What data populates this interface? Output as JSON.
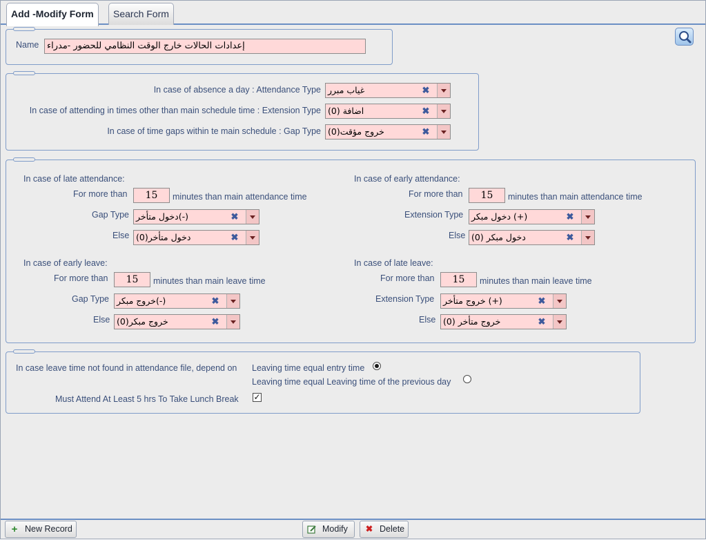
{
  "tabs": [
    {
      "label": "Add -Modify Form",
      "active": true
    },
    {
      "label": "Search Form",
      "active": false
    }
  ],
  "name_section": {
    "label": "Name",
    "value": "إعدادات الحالات  خارج الوقت النظامي للحضور -مدراء"
  },
  "types_section": {
    "absence_label": "In case of absence a day : Attendance Type",
    "absence_value": "غياب مبرر",
    "extension_label": "In case of attending in times other than main schedule time : Extension Type",
    "extension_value": "اضافة (0)",
    "gap_label": "In case of time gaps within te main schedule : Gap Type",
    "gap_value": "خروج مؤقت(0)"
  },
  "rules_section": {
    "late_attendance": {
      "header": "In case of late attendance:",
      "for_more_than": "For more than",
      "minutes": "15",
      "suffix": "minutes than main attendance time",
      "type_label": "Gap Type",
      "type_value": "دخول متأخر(-)",
      "else_label": "Else",
      "else_value": "دخول متأخر(0)"
    },
    "early_attendance": {
      "header": "In case of early attendance:",
      "for_more_than": "For more than",
      "minutes": "15",
      "suffix": "minutes than main attendance time",
      "type_label": "Extension Type",
      "type_value": "دخول مبكر (+)",
      "else_label": "Else",
      "else_value": "دخول مبكر (0)"
    },
    "early_leave": {
      "header": "In case of early leave:",
      "for_more_than": "For more than",
      "minutes": "15",
      "suffix": "minutes than main leave time",
      "type_label": "Gap Type",
      "type_value": "خروج مبكر(-)",
      "else_label": "Else",
      "else_value": "خروج مبكر(0)"
    },
    "late_leave": {
      "header": "In case of late leave:",
      "for_more_than": "For more than",
      "minutes": "15",
      "suffix": "minutes than main leave time",
      "type_label": "Extension Type",
      "type_value": "خروج متأخر (+)",
      "else_label": "Else",
      "else_value": "خروج متأخر (0)"
    }
  },
  "leave_section": {
    "depend_label": "In case leave time not found in attendance file, depend on",
    "option1": "Leaving time equal entry time",
    "option1_selected": true,
    "option2": "Leaving time equal Leaving time of the previous day",
    "option2_selected": false,
    "lunch_label": "Must Attend At Least 5 hrs To Take Lunch Break",
    "lunch_checked": true
  },
  "footer": {
    "new_record": "New Record",
    "modify": "Modify",
    "delete": "Delete"
  },
  "icons": {
    "search": "magnifier-icon",
    "clear": "clear-x-icon",
    "dropdown": "chevron-down-icon",
    "new": "plus-icon",
    "modify": "edit-icon",
    "delete": "x-icon"
  },
  "colors": {
    "accent": "#6b8fc4",
    "field_bg": "#ffd9d9",
    "label_text": "#3a4f7a"
  }
}
